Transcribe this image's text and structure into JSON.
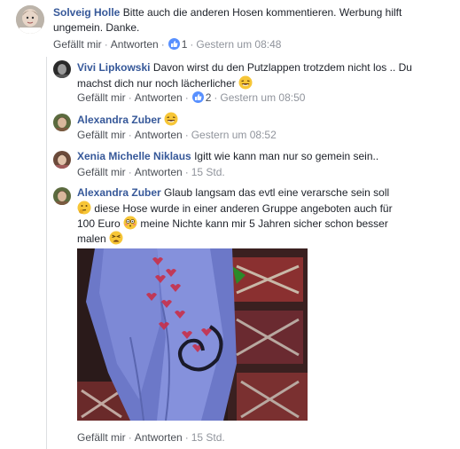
{
  "comments": [
    {
      "author": "Solveig Holle",
      "text_line1": "Bitte auch die anderen Hosen kommentieren. Werbung hilft",
      "text_line2": "ungemein. Danke.",
      "like_label": "Gefällt mir",
      "reply_label": "Antworten",
      "reaction_count": "1",
      "timestamp": "Gestern um 08:48"
    },
    {
      "author": "Vivi Lipkowski",
      "text_line1": "Davon wirst du den Putzlappen trotzdem nicht los .. Du",
      "text_line2": "machst dich nur noch lächerlicher",
      "like_label": "Gefällt mir",
      "reply_label": "Antworten",
      "reaction_count": "2",
      "timestamp": "Gestern um 08:50"
    },
    {
      "author": "Alexandra Zuber",
      "like_label": "Gefällt mir",
      "reply_label": "Antworten",
      "timestamp": "Gestern um 08:52"
    },
    {
      "author": "Xenia Michelle Niklaus",
      "text_line1": "Igitt wie kann man nur so gemein sein..",
      "like_label": "Gefällt mir",
      "reply_label": "Antworten",
      "timestamp": "15 Std."
    },
    {
      "author": "Alexandra Zuber",
      "text_line1": "Glaub langsam das evtl eine verarsche sein soll",
      "text_line2": "diese Hose wurde in einer anderen Gruppe angeboten auch für",
      "text_line3a": "100 Euro",
      "text_line3b": "meine Nichte kann mir 5 Jahren sicher schon besser",
      "text_line4": "malen",
      "like_label": "Gefällt mir",
      "reply_label": "Antworten",
      "timestamp": "15 Std."
    }
  ],
  "icons": {
    "reaction": "like-thumb-icon",
    "emoji_laugh": "laughing-emoji-icon",
    "emoji_think": "thinking-emoji-icon",
    "emoji_flushed": "flushed-emoji-icon",
    "emoji_tired": "tired-emoji-icon"
  },
  "colors": {
    "name": "#365899",
    "meta": "#90949c",
    "action": "#4b4f56",
    "like_badge": "#5890ff"
  }
}
